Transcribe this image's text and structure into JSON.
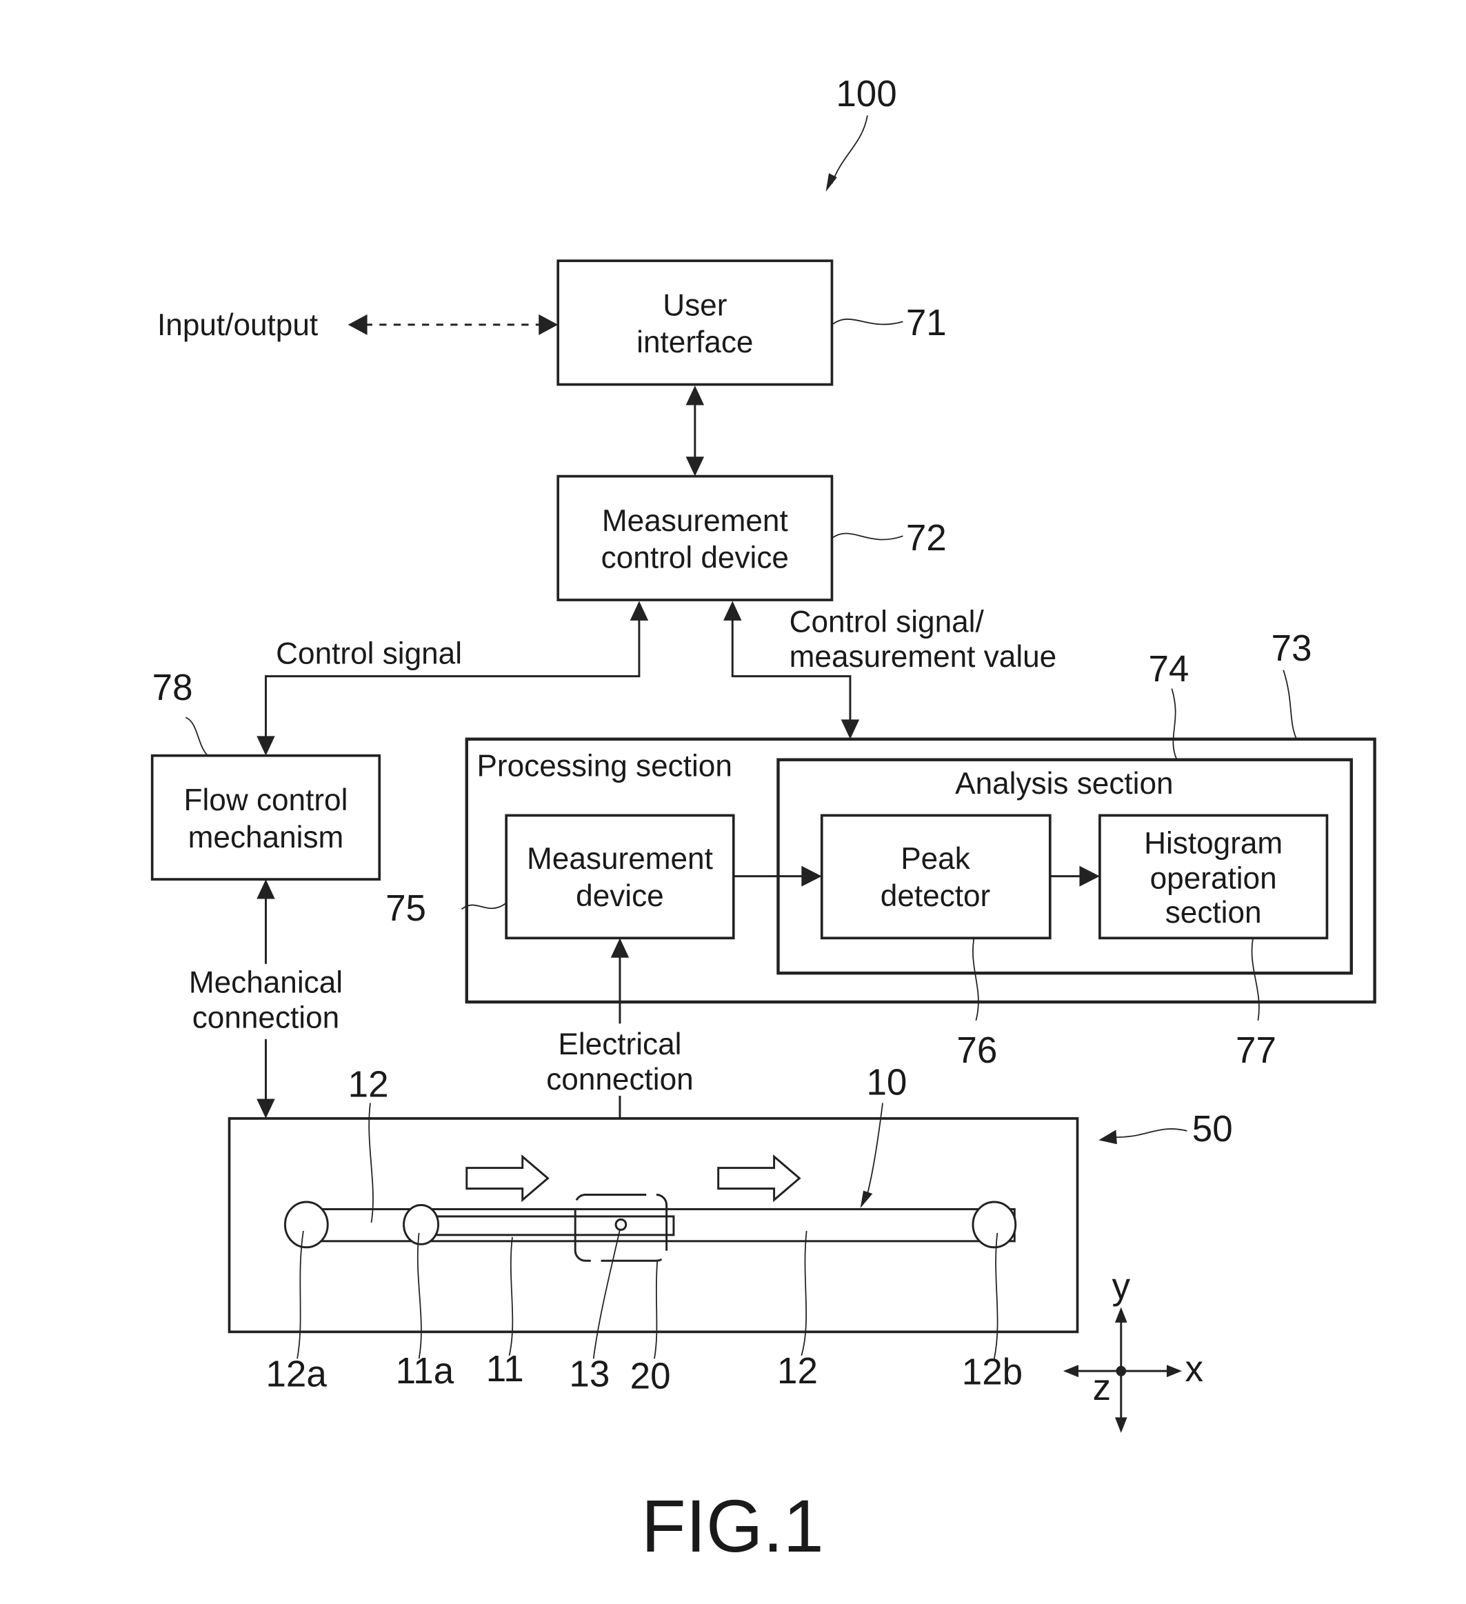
{
  "figure": {
    "caption": "FIG.1",
    "system_ref": "100"
  },
  "blocks": {
    "user_interface": {
      "lines": [
        "User",
        "interface"
      ],
      "ref": "71"
    },
    "measurement_control_device": {
      "lines": [
        "Measurement",
        "control device"
      ],
      "ref": "72"
    },
    "processing_section": {
      "title": "Processing section",
      "ref": "73"
    },
    "analysis_section": {
      "title": "Analysis section",
      "ref": "74"
    },
    "measurement_device": {
      "lines": [
        "Measurement",
        "device"
      ],
      "ref": "75"
    },
    "peak_detector": {
      "lines": [
        "Peak",
        "detector"
      ],
      "ref": "76"
    },
    "histogram_operation_section": {
      "lines": [
        "Histogram",
        "operation",
        "section"
      ],
      "ref": "77"
    },
    "flow_control_mechanism": {
      "lines": [
        "Flow control",
        "mechanism"
      ],
      "ref": "78"
    }
  },
  "connections": {
    "input_output": "Input/output",
    "control_signal": "Control signal",
    "control_signal_measurement": [
      "Control signal/",
      "measurement value"
    ],
    "mechanical_connection": [
      "Mechanical",
      "connection"
    ],
    "electrical_connection": [
      "Electrical",
      "connection"
    ]
  },
  "chip": {
    "ref": "50",
    "channel_ref": "10",
    "labels": {
      "upper_12": "12",
      "lower_12": "12",
      "12a": "12a",
      "11a": "11a",
      "11": "11",
      "13": "13",
      "20": "20",
      "12b": "12b"
    }
  },
  "axes": {
    "x": "x",
    "y": "y",
    "z": "z"
  }
}
